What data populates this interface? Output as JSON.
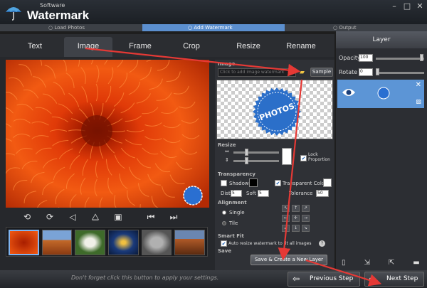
{
  "app": {
    "brand_small": "Software",
    "brand": "Watermark"
  },
  "window_controls": [
    "minimize",
    "maximize",
    "close"
  ],
  "steps": {
    "load": "○ Load Photos",
    "add": "○ Add Watermark",
    "output": "○ Output"
  },
  "tabs": [
    "Text",
    "Image",
    "Frame",
    "Crop",
    "Resize",
    "Rename"
  ],
  "tabs_active": "Image",
  "image_panel": {
    "section": "Image",
    "path_placeholder": "Click to add image watermark",
    "sample_label": "Sample",
    "wm_text": "PHOTOS"
  },
  "resize": {
    "title": "Resize",
    "lock_label": "Lock Proportion",
    "lock_checked": true
  },
  "transparency": {
    "title": "Transparency",
    "shadow_label": "Shadow",
    "transparent_label": "Transparent Color",
    "dist_label": "Dist",
    "dist_value": "5",
    "soft_label": "Soft",
    "soft_value": "5",
    "tolerance_label": "Tolerance",
    "tolerance_value": "50"
  },
  "alignment": {
    "title": "Alignment",
    "single_label": "Single",
    "tile_label": "Tile"
  },
  "smart_fit": {
    "title": "Smart Fit",
    "auto_label": "Auto resize watermark to fit all images"
  },
  "save_section": "Save",
  "save_button": "Save & Create a New Layer",
  "layer": {
    "title": "Layer",
    "opacity_label": "Opacity",
    "opacity_value": "100",
    "rotate_label": "Rotate",
    "rotate_value": "0"
  },
  "bottom": {
    "hint": "Don't forget click this button to apply your settings.",
    "prev": "Previous Step",
    "next": "Next Step"
  },
  "colors": {
    "accent": "#5b8fcf",
    "arrow": "#e53935",
    "selected_layer": "#5c95d6"
  }
}
